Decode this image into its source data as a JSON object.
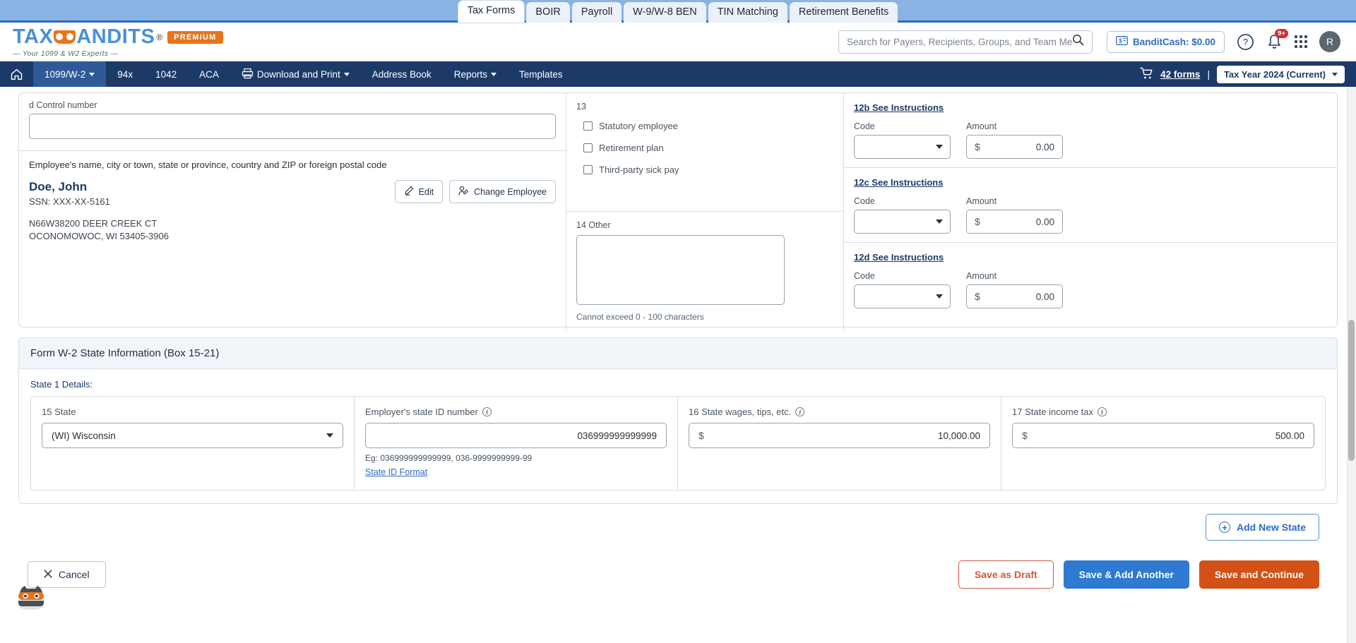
{
  "top_tabs": [
    {
      "label": "Tax Forms",
      "active": true
    },
    {
      "label": "BOIR",
      "active": false
    },
    {
      "label": "Payroll",
      "active": false
    },
    {
      "label": "W-9/W-8 BEN",
      "active": false
    },
    {
      "label": "TIN Matching",
      "active": false
    },
    {
      "label": "Retirement Benefits",
      "active": false
    }
  ],
  "brand": {
    "name_left": "TAX",
    "name_right": "ANDITS",
    "registered": "®",
    "premium": "PREMIUM",
    "tagline": "— Your 1099 & W2 Experts —"
  },
  "search": {
    "placeholder": "Search for Payers, Recipients, Groups, and Team Members",
    "value": ""
  },
  "header_right": {
    "bandit_cash": "BanditCash: $0.00",
    "notification_badge": "9+",
    "avatar_initial": "R"
  },
  "nav": {
    "items": [
      {
        "label": "1099/W-2",
        "caret": true,
        "active": true
      },
      {
        "label": "94x",
        "caret": false,
        "active": false
      },
      {
        "label": "1042",
        "caret": false,
        "active": false
      },
      {
        "label": "ACA",
        "caret": false,
        "active": false
      },
      {
        "label": "Download and Print",
        "caret": true,
        "active": false
      },
      {
        "label": "Address Book",
        "caret": false,
        "active": false
      },
      {
        "label": "Reports",
        "caret": true,
        "active": false
      },
      {
        "label": "Templates",
        "caret": false,
        "active": false
      }
    ],
    "cart_forms": "42 forms",
    "divider": "|",
    "tax_year": "Tax Year 2024 (Current)"
  },
  "form": {
    "control_number_label": "d   Control number",
    "control_number_value": "",
    "employee_header": "Employee's name, city or town, state or province, country and ZIP or foreign postal code",
    "employee_name": "Doe, John",
    "employee_ssn": "SSN: XXX-XX-5161",
    "employee_address_line1": "N66W38200 DEER CREEK CT",
    "employee_address_line2": "OCONOMOWOC, WI 53405-3906",
    "edit_button": "Edit",
    "change_employee_button": "Change Employee",
    "box13_number": "13",
    "box13_checkboxes": [
      {
        "label": "Statutory employee",
        "checked": false
      },
      {
        "label": "Retirement plan",
        "checked": false
      },
      {
        "label": "Third-party sick pay",
        "checked": false
      }
    ],
    "box14_label": "14  Other",
    "box14_value": "",
    "box14_hint": "Cannot exceed 0 - 100 characters",
    "box12_rows": [
      {
        "title": "12b See Instructions",
        "code_label": "Code",
        "code_value": "",
        "amount_label": "Amount",
        "amount_value": "0.00"
      },
      {
        "title": "12c See Instructions",
        "code_label": "Code",
        "code_value": "",
        "amount_label": "Amount",
        "amount_value": "0.00"
      },
      {
        "title": "12d See Instructions",
        "code_label": "Code",
        "code_value": "",
        "amount_label": "Amount",
        "amount_value": "0.00"
      }
    ]
  },
  "state_section": {
    "title": "Form W-2 State Information (Box 15-21)",
    "details_label": "State 1 Details:",
    "state_label": "15  State",
    "state_value": "(WI) Wisconsin",
    "employer_state_id_label": "Employer's state ID number",
    "employer_state_id_value": "036999999999999",
    "employer_state_id_eg": "Eg: 036999999999999, 036-9999999999-99",
    "state_id_format_link": "State ID Format",
    "state_wages_label": "16  State wages, tips, etc.",
    "state_wages_value": "10,000.00",
    "state_income_tax_label": "17  State income tax",
    "state_income_tax_value": "500.00",
    "dollar": "$",
    "add_new_state": "Add New State"
  },
  "footer": {
    "cancel": "Cancel",
    "save_as_draft": "Save as Draft",
    "save_add_another": "Save & Add Another",
    "save_and_continue": "Save and Continue"
  }
}
